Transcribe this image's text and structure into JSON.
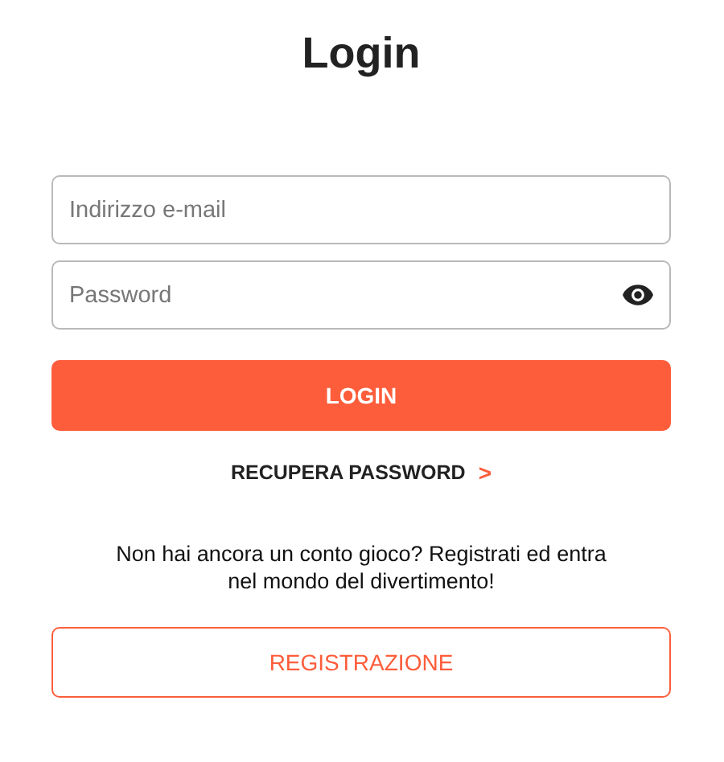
{
  "title": "Login",
  "fields": [
    {
      "kind": "email",
      "placeholder": "Indirizzo e-mail"
    },
    {
      "kind": "password",
      "placeholder": "Password"
    }
  ],
  "login_button": "LOGIN",
  "recover_link": "RECUPERA PASSWORD",
  "recover_arrow": ">",
  "signup_text": "Non hai ancora un conto gioco? Registrati ed entra nel mondo del divertimento!",
  "signup_button": "REGISTRAZIONE"
}
